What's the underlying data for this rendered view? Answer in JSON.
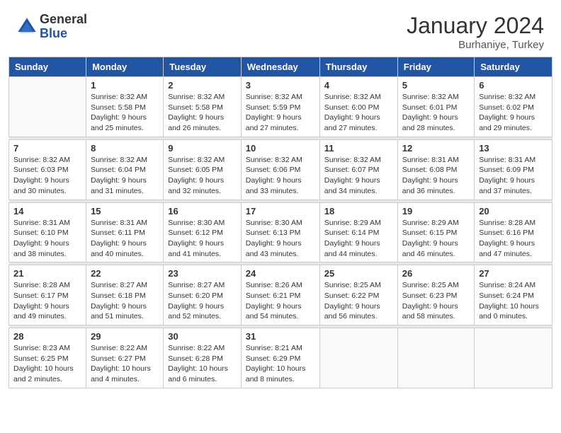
{
  "header": {
    "logo_general": "General",
    "logo_blue": "Blue",
    "month_title": "January 2024",
    "subtitle": "Burhaniye, Turkey"
  },
  "days": [
    "Sunday",
    "Monday",
    "Tuesday",
    "Wednesday",
    "Thursday",
    "Friday",
    "Saturday"
  ],
  "weeks": [
    [
      {
        "date": "",
        "sunrise": "",
        "sunset": "",
        "daylight": ""
      },
      {
        "date": "1",
        "sunrise": "Sunrise: 8:32 AM",
        "sunset": "Sunset: 5:58 PM",
        "daylight": "Daylight: 9 hours and 25 minutes."
      },
      {
        "date": "2",
        "sunrise": "Sunrise: 8:32 AM",
        "sunset": "Sunset: 5:58 PM",
        "daylight": "Daylight: 9 hours and 26 minutes."
      },
      {
        "date": "3",
        "sunrise": "Sunrise: 8:32 AM",
        "sunset": "Sunset: 5:59 PM",
        "daylight": "Daylight: 9 hours and 27 minutes."
      },
      {
        "date": "4",
        "sunrise": "Sunrise: 8:32 AM",
        "sunset": "Sunset: 6:00 PM",
        "daylight": "Daylight: 9 hours and 27 minutes."
      },
      {
        "date": "5",
        "sunrise": "Sunrise: 8:32 AM",
        "sunset": "Sunset: 6:01 PM",
        "daylight": "Daylight: 9 hours and 28 minutes."
      },
      {
        "date": "6",
        "sunrise": "Sunrise: 8:32 AM",
        "sunset": "Sunset: 6:02 PM",
        "daylight": "Daylight: 9 hours and 29 minutes."
      }
    ],
    [
      {
        "date": "7",
        "sunrise": "Sunrise: 8:32 AM",
        "sunset": "Sunset: 6:03 PM",
        "daylight": "Daylight: 9 hours and 30 minutes."
      },
      {
        "date": "8",
        "sunrise": "Sunrise: 8:32 AM",
        "sunset": "Sunset: 6:04 PM",
        "daylight": "Daylight: 9 hours and 31 minutes."
      },
      {
        "date": "9",
        "sunrise": "Sunrise: 8:32 AM",
        "sunset": "Sunset: 6:05 PM",
        "daylight": "Daylight: 9 hours and 32 minutes."
      },
      {
        "date": "10",
        "sunrise": "Sunrise: 8:32 AM",
        "sunset": "Sunset: 6:06 PM",
        "daylight": "Daylight: 9 hours and 33 minutes."
      },
      {
        "date": "11",
        "sunrise": "Sunrise: 8:32 AM",
        "sunset": "Sunset: 6:07 PM",
        "daylight": "Daylight: 9 hours and 34 minutes."
      },
      {
        "date": "12",
        "sunrise": "Sunrise: 8:31 AM",
        "sunset": "Sunset: 6:08 PM",
        "daylight": "Daylight: 9 hours and 36 minutes."
      },
      {
        "date": "13",
        "sunrise": "Sunrise: 8:31 AM",
        "sunset": "Sunset: 6:09 PM",
        "daylight": "Daylight: 9 hours and 37 minutes."
      }
    ],
    [
      {
        "date": "14",
        "sunrise": "Sunrise: 8:31 AM",
        "sunset": "Sunset: 6:10 PM",
        "daylight": "Daylight: 9 hours and 38 minutes."
      },
      {
        "date": "15",
        "sunrise": "Sunrise: 8:31 AM",
        "sunset": "Sunset: 6:11 PM",
        "daylight": "Daylight: 9 hours and 40 minutes."
      },
      {
        "date": "16",
        "sunrise": "Sunrise: 8:30 AM",
        "sunset": "Sunset: 6:12 PM",
        "daylight": "Daylight: 9 hours and 41 minutes."
      },
      {
        "date": "17",
        "sunrise": "Sunrise: 8:30 AM",
        "sunset": "Sunset: 6:13 PM",
        "daylight": "Daylight: 9 hours and 43 minutes."
      },
      {
        "date": "18",
        "sunrise": "Sunrise: 8:29 AM",
        "sunset": "Sunset: 6:14 PM",
        "daylight": "Daylight: 9 hours and 44 minutes."
      },
      {
        "date": "19",
        "sunrise": "Sunrise: 8:29 AM",
        "sunset": "Sunset: 6:15 PM",
        "daylight": "Daylight: 9 hours and 46 minutes."
      },
      {
        "date": "20",
        "sunrise": "Sunrise: 8:28 AM",
        "sunset": "Sunset: 6:16 PM",
        "daylight": "Daylight: 9 hours and 47 minutes."
      }
    ],
    [
      {
        "date": "21",
        "sunrise": "Sunrise: 8:28 AM",
        "sunset": "Sunset: 6:17 PM",
        "daylight": "Daylight: 9 hours and 49 minutes."
      },
      {
        "date": "22",
        "sunrise": "Sunrise: 8:27 AM",
        "sunset": "Sunset: 6:18 PM",
        "daylight": "Daylight: 9 hours and 51 minutes."
      },
      {
        "date": "23",
        "sunrise": "Sunrise: 8:27 AM",
        "sunset": "Sunset: 6:20 PM",
        "daylight": "Daylight: 9 hours and 52 minutes."
      },
      {
        "date": "24",
        "sunrise": "Sunrise: 8:26 AM",
        "sunset": "Sunset: 6:21 PM",
        "daylight": "Daylight: 9 hours and 54 minutes."
      },
      {
        "date": "25",
        "sunrise": "Sunrise: 8:25 AM",
        "sunset": "Sunset: 6:22 PM",
        "daylight": "Daylight: 9 hours and 56 minutes."
      },
      {
        "date": "26",
        "sunrise": "Sunrise: 8:25 AM",
        "sunset": "Sunset: 6:23 PM",
        "daylight": "Daylight: 9 hours and 58 minutes."
      },
      {
        "date": "27",
        "sunrise": "Sunrise: 8:24 AM",
        "sunset": "Sunset: 6:24 PM",
        "daylight": "Daylight: 10 hours and 0 minutes."
      }
    ],
    [
      {
        "date": "28",
        "sunrise": "Sunrise: 8:23 AM",
        "sunset": "Sunset: 6:25 PM",
        "daylight": "Daylight: 10 hours and 2 minutes."
      },
      {
        "date": "29",
        "sunrise": "Sunrise: 8:22 AM",
        "sunset": "Sunset: 6:27 PM",
        "daylight": "Daylight: 10 hours and 4 minutes."
      },
      {
        "date": "30",
        "sunrise": "Sunrise: 8:22 AM",
        "sunset": "Sunset: 6:28 PM",
        "daylight": "Daylight: 10 hours and 6 minutes."
      },
      {
        "date": "31",
        "sunrise": "Sunrise: 8:21 AM",
        "sunset": "Sunset: 6:29 PM",
        "daylight": "Daylight: 10 hours and 8 minutes."
      },
      {
        "date": "",
        "sunrise": "",
        "sunset": "",
        "daylight": ""
      },
      {
        "date": "",
        "sunrise": "",
        "sunset": "",
        "daylight": ""
      },
      {
        "date": "",
        "sunrise": "",
        "sunset": "",
        "daylight": ""
      }
    ]
  ]
}
